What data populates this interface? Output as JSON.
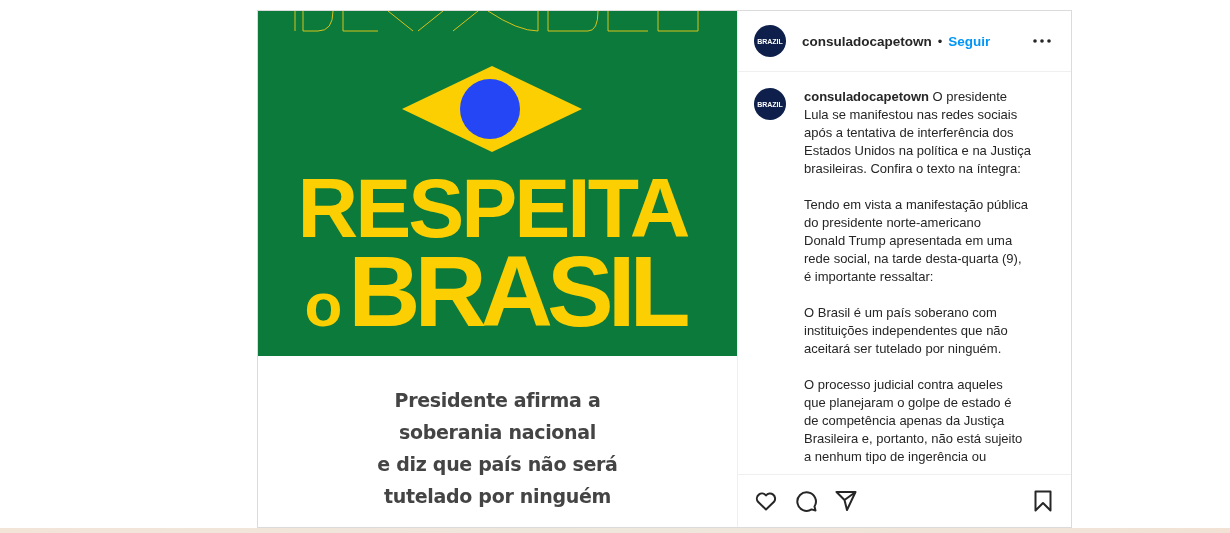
{
  "post": {
    "image": {
      "headline": "RESPEITA",
      "small_word": "o",
      "word": "BRASIL",
      "subtitle_lines": [
        "Presidente afirma a",
        "**soberania nacional**",
        "e diz que país não será",
        "tutelado por ninguém"
      ]
    },
    "header": {
      "avatar_text": "BRAZIL",
      "username": "consuladocapetown",
      "separator": "•",
      "follow": "Seguir"
    },
    "caption": {
      "avatar_text": "BRAZIL",
      "username": "consuladocapetown",
      "paragraphs": [
        [
          "O presidente",
          "Lula se manifestou nas redes sociais",
          "após a tentativa de interferência dos",
          "Estados Unidos na política e na Justiça",
          "brasileiras. Confira o texto na íntegra:"
        ],
        [
          "Tendo em vista a manifestação pública",
          "do presidente norte-americano",
          "Donald Trump apresentada em uma",
          "rede social, na tarde desta-quarta (9),",
          "é importante ressaltar:"
        ],
        [
          "O Brasil é um país soberano com",
          "instituições independentes que não",
          "aceitará ser tutelado por ninguém."
        ],
        [
          "O processo judicial contra aqueles",
          "que planejaram o golpe de estado é",
          "de competência apenas da Justiça",
          "Brasileira e, portanto, não está sujeito",
          "a nenhum tipo de ingerência ou"
        ]
      ]
    }
  }
}
